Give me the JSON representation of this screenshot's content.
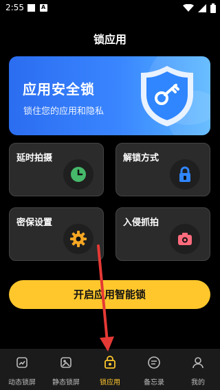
{
  "status_bar": {
    "time": "2:55",
    "icons": [
      "notification-icon",
      "app-icon",
      "wifi-icon",
      "signal-icon",
      "battery-icon"
    ]
  },
  "app": {
    "title": "锁应用"
  },
  "banner": {
    "title": "应用安全锁",
    "subtitle": "锁住您的应用和隐私",
    "icon": "shield-key-icon"
  },
  "cards": [
    {
      "label": "延时拍摄",
      "icon": "clock-icon"
    },
    {
      "label": "解锁方式",
      "icon": "padlock-icon"
    },
    {
      "label": "密保设置",
      "icon": "gear-icon"
    },
    {
      "label": "入侵抓拍",
      "icon": "camera-icon"
    }
  ],
  "primary_button": {
    "label": "开启应用智能锁"
  },
  "tabs": [
    {
      "label": "动态锁屏",
      "icon": "dynamic-wallpaper-icon",
      "active": false
    },
    {
      "label": "静态锁屏",
      "icon": "static-wallpaper-icon",
      "active": false
    },
    {
      "label": "锁应用",
      "icon": "app-lock-icon",
      "active": true
    },
    {
      "label": "备忘录",
      "icon": "memo-icon",
      "active": false
    },
    {
      "label": "我的",
      "icon": "profile-icon",
      "active": false
    }
  ],
  "colors": {
    "accent": "#ffc72c",
    "banner_blue": "#3a86ff",
    "card_bg": "#2b2b2b",
    "clock_green": "#46b86a",
    "lock_blue": "#2f86ff",
    "gear_orange": "#f5a623",
    "camera_pink": "#ff6b7d",
    "annotation_red": "#e53935"
  }
}
